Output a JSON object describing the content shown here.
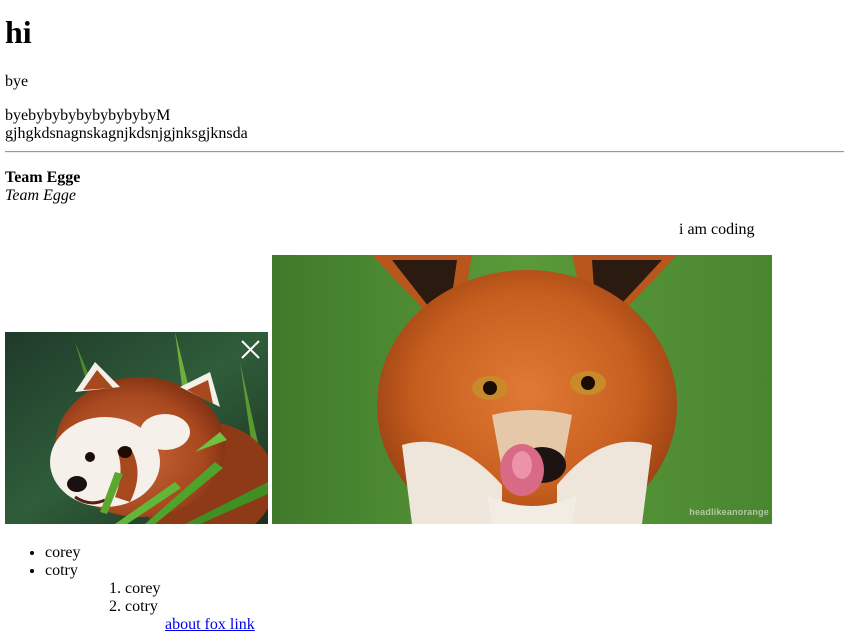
{
  "heading": "hi",
  "bye": "bye",
  "long_line_1": "byebybybybybybybybyM",
  "long_line_2": "gjhgkdsnagnskagnjkdsnjgjnksgjknsda",
  "team_bold": "Team Egge",
  "team_italic": "Team Egge",
  "coding_text": "i am coding",
  "images": {
    "panda": {
      "icon": "close-x-icon"
    },
    "fox": {
      "watermark": "headlikeanorange"
    }
  },
  "unordered_list": [
    "corey",
    "cotry"
  ],
  "ordered_list": [
    "corey",
    "cotry"
  ],
  "link_text": "about fox link",
  "colors": {
    "link": "#0000ee",
    "rule": "#9a9a9a"
  }
}
